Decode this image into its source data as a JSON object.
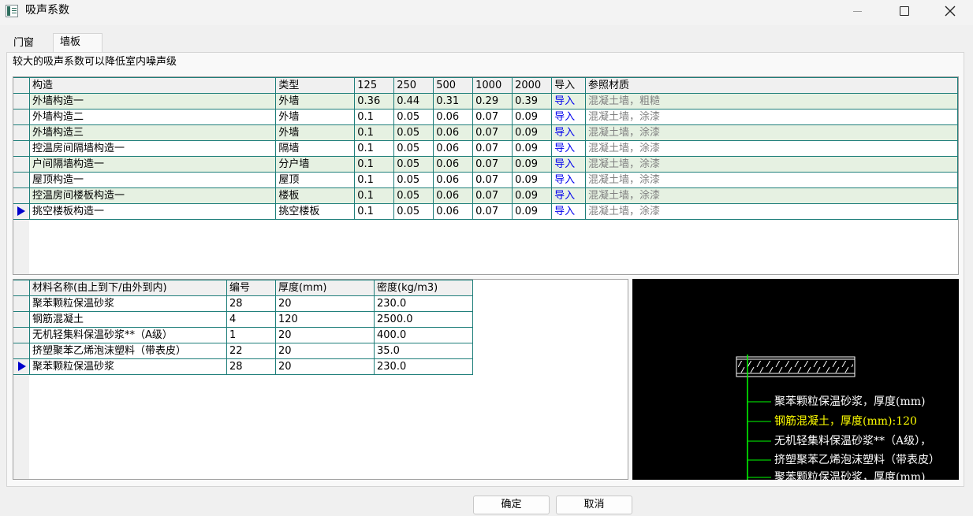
{
  "window": {
    "title": "吸声系数"
  },
  "tabs": [
    {
      "label": "门窗"
    },
    {
      "label": "墙板"
    }
  ],
  "hint": "较大的吸声系数可以降低室内噪声级",
  "construction_table": {
    "headers": [
      "构造",
      "类型",
      "125",
      "250",
      "500",
      "1000",
      "2000",
      "导入",
      "参照材质"
    ],
    "rows": [
      [
        "外墙构造一",
        "外墙",
        "0.36",
        "0.44",
        "0.31",
        "0.29",
        "0.39",
        "导入",
        "混凝土墙，粗糙"
      ],
      [
        "外墙构造二",
        "外墙",
        "0.1",
        "0.05",
        "0.06",
        "0.07",
        "0.09",
        "导入",
        "混凝土墙，涂漆"
      ],
      [
        "外墙构造三",
        "外墙",
        "0.1",
        "0.05",
        "0.06",
        "0.07",
        "0.09",
        "导入",
        "混凝土墙，涂漆"
      ],
      [
        "控温房间隔墙构造一",
        "隔墙",
        "0.1",
        "0.05",
        "0.06",
        "0.07",
        "0.09",
        "导入",
        "混凝土墙，涂漆"
      ],
      [
        "户间隔墙构造一",
        "分户墙",
        "0.1",
        "0.05",
        "0.06",
        "0.07",
        "0.09",
        "导入",
        "混凝土墙，涂漆"
      ],
      [
        "屋顶构造一",
        "屋顶",
        "0.1",
        "0.05",
        "0.06",
        "0.07",
        "0.09",
        "导入",
        "混凝土墙，涂漆"
      ],
      [
        "控温房间楼板构造一",
        "楼板",
        "0.1",
        "0.05",
        "0.06",
        "0.07",
        "0.09",
        "导入",
        "混凝土墙，涂漆"
      ],
      [
        "挑空楼板构造一",
        "挑空楼板",
        "0.1",
        "0.05",
        "0.06",
        "0.07",
        "0.09",
        "导入",
        "混凝土墙，涂漆"
      ]
    ]
  },
  "material_table": {
    "headers": [
      "材料名称(由上到下/由外到内)",
      "编号",
      "厚度(mm)",
      "密度(kg/m3)"
    ],
    "rows": [
      [
        "聚苯颗粒保温砂浆",
        "28",
        "20",
        "230.0"
      ],
      [
        "钢筋混凝土",
        "4",
        "120",
        "2500.0"
      ],
      [
        "无机轻集料保温砂浆**（A级）",
        "1",
        "20",
        "400.0"
      ],
      [
        "挤塑聚苯乙烯泡沫塑料（带表皮）",
        "22",
        "20",
        "35.0"
      ],
      [
        "聚苯颗粒保温砂浆",
        "28",
        "20",
        "230.0"
      ]
    ]
  },
  "preview": {
    "labels": [
      {
        "text": "聚苯颗粒保温砂浆，厚度(mm)",
        "color": "#ffffff"
      },
      {
        "text": "钢筋混凝土，厚度(mm):120",
        "color": "#ffff00"
      },
      {
        "text": "无机轻集料保温砂浆**（A级），",
        "color": "#ffffff"
      },
      {
        "text": "挤塑聚苯乙烯泡沫塑料（带表皮）",
        "color": "#ffffff"
      },
      {
        "text": "聚苯颗粒保温砂浆，厚度(mm)",
        "color": "#ffffff"
      }
    ],
    "leader_color": "#00ff00"
  },
  "buttons": {
    "ok": "确定",
    "cancel": "取消"
  },
  "colors": {
    "grid_line": "#1e7e7a",
    "row_alt": "#e6f1e2",
    "link": "#0000ee",
    "marker": "#0000cc"
  }
}
